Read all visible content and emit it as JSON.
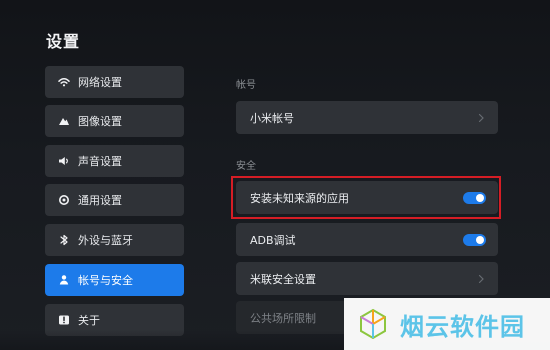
{
  "page": {
    "title": "设置"
  },
  "sidebar": {
    "items": [
      {
        "label": "网络设置",
        "icon": "wifi-icon"
      },
      {
        "label": "图像设置",
        "icon": "image-mountain-icon"
      },
      {
        "label": "声音设置",
        "icon": "speaker-icon"
      },
      {
        "label": "通用设置",
        "icon": "gear-icon"
      },
      {
        "label": "外设与蓝牙",
        "icon": "bluetooth-icon"
      },
      {
        "label": "帐号与安全",
        "icon": "account-icon",
        "active": true
      },
      {
        "label": "关于",
        "icon": "info-icon"
      }
    ]
  },
  "main": {
    "account_section": {
      "label": "帐号",
      "rows": [
        {
          "label": "小米帐号",
          "control": "chevron"
        }
      ]
    },
    "security_section": {
      "label": "安全",
      "rows": [
        {
          "label": "安装未知来源的应用",
          "control": "toggle",
          "enabled": true,
          "highlighted": true
        },
        {
          "label": "ADB调试",
          "control": "toggle",
          "enabled": true
        },
        {
          "label": "米联安全设置",
          "control": "chevron"
        },
        {
          "label": "公共场所限制",
          "control": "none"
        }
      ]
    }
  },
  "watermark": {
    "text": "烟云软件园"
  },
  "colors": {
    "accent": "#1d7bea",
    "highlight_border": "#d51d25",
    "panel_background": "#2f3237",
    "page_background": "#171a1f",
    "watermark_text": "#5cc4e8"
  }
}
